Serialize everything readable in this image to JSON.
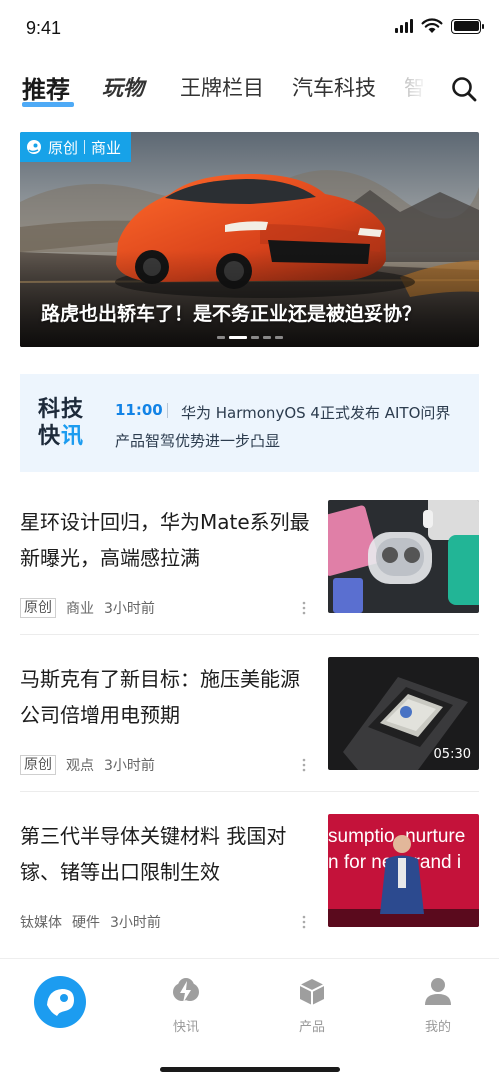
{
  "status_bar": {
    "time": "9:41"
  },
  "nav": {
    "tabs": [
      {
        "label": "推荐",
        "active": true
      },
      {
        "label": "玩物",
        "active": false
      },
      {
        "label": "王牌栏目",
        "active": false
      },
      {
        "label": "汽车科技",
        "active": false
      },
      {
        "label": "智",
        "active": false
      }
    ],
    "search_icon": "search-icon"
  },
  "banner": {
    "badge_brand": "原创",
    "badge_category": "商业",
    "title": "路虎也出轿车了！是不务正业还是被迫妥协？",
    "slide_count": 5,
    "active_slide": 2
  },
  "flash": {
    "logo_line1": "科技",
    "logo_line2_a": "快",
    "logo_line2_b": "讯",
    "time": "11:00",
    "text": "华为 HarmonyOS 4正式发布 AITO问界产品智驾优势进一步凸显"
  },
  "articles": [
    {
      "title": "星环设计回归，华为Mate系列最新曝光，高端感拉满",
      "tag": "原创",
      "category": "商业",
      "time": "3小时前",
      "duration": ""
    },
    {
      "title": "马斯克有了新目标：施压美能源公司倍增用电预期",
      "tag": "原创",
      "category": "观点",
      "time": "3小时前",
      "duration": "05:30"
    },
    {
      "title": "第三代半导体关键材料 我国对镓、锗等出口限制生效",
      "tag": "",
      "source": "钛媒体",
      "category": "硬件",
      "time": "3小时前",
      "duration": "",
      "thumb_text_1": "sumptio  nurture",
      "thumb_text_2": "n for ne  orand i"
    }
  ],
  "tab_bar": {
    "items": [
      {
        "label": "",
        "icon": "home-logo-icon",
        "active": true
      },
      {
        "label": "快讯",
        "icon": "flash-icon",
        "active": false
      },
      {
        "label": "产品",
        "icon": "cube-icon",
        "active": false
      },
      {
        "label": "我的",
        "icon": "person-icon",
        "active": false
      }
    ]
  },
  "colors": {
    "accent": "#1c9cf0",
    "badge": "#17a2e8",
    "flash_bg": "#edf5fd",
    "text": "#1c1c1c",
    "muted": "#9a9a9a"
  }
}
